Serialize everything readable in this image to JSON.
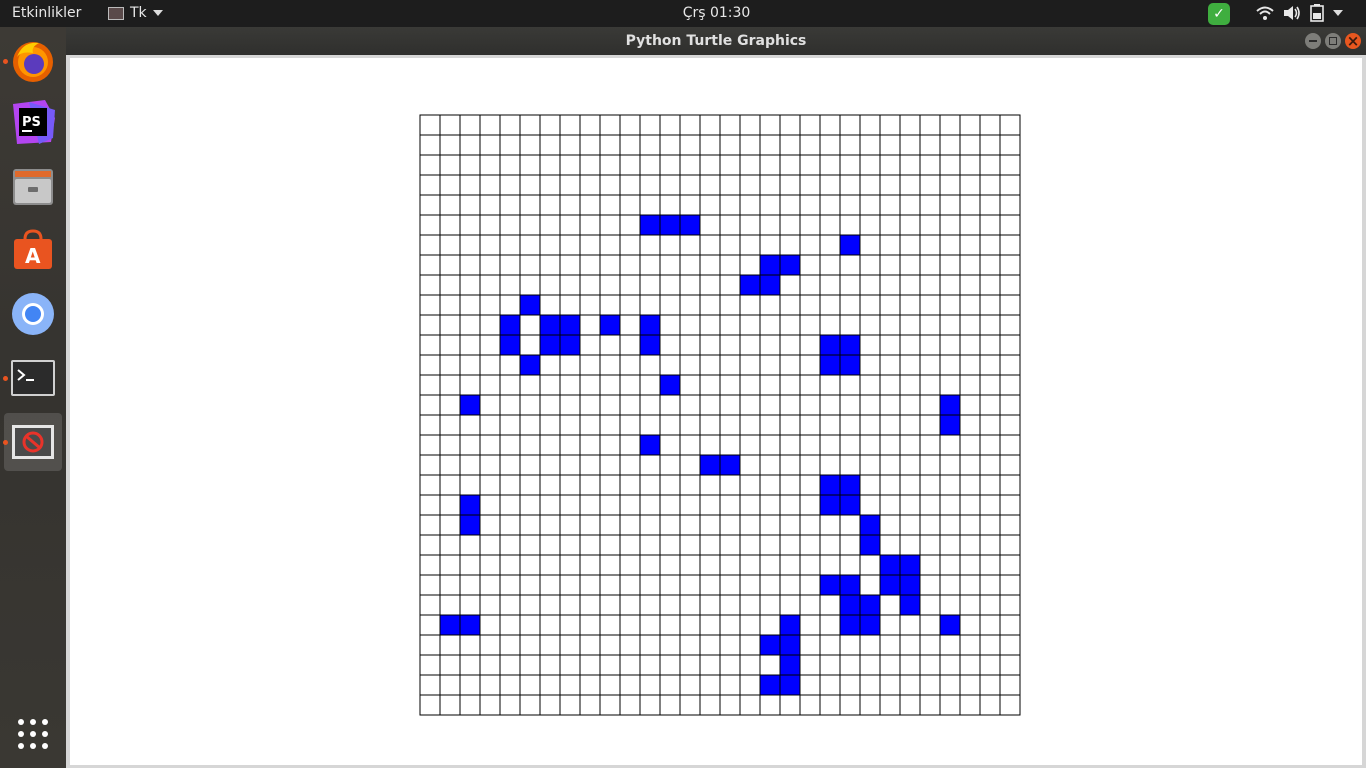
{
  "topbar": {
    "activities": "Etkinlikler",
    "app_name": "Tk",
    "clock": "Çrş 01:30"
  },
  "dock": {
    "items": [
      {
        "name": "firefox-icon",
        "running": true
      },
      {
        "name": "phpstorm-icon",
        "running": false
      },
      {
        "name": "files-icon",
        "running": false
      },
      {
        "name": "software-center-icon",
        "running": false
      },
      {
        "name": "chromium-icon",
        "running": false
      },
      {
        "name": "terminal-icon",
        "running": true
      },
      {
        "name": "tk-window-icon",
        "running": true,
        "active": true
      }
    ],
    "apps_grid_icon": "show-applications-icon"
  },
  "window": {
    "title": "Python Turtle Graphics"
  },
  "grid": {
    "rows": 30,
    "cols": 30,
    "fill_color": "#0000ff",
    "line_color": "#000000",
    "filled_cells": [
      [
        5,
        11
      ],
      [
        5,
        12
      ],
      [
        5,
        13
      ],
      [
        6,
        21
      ],
      [
        7,
        17
      ],
      [
        7,
        18
      ],
      [
        8,
        16
      ],
      [
        8,
        17
      ],
      [
        9,
        5
      ],
      [
        10,
        4
      ],
      [
        10,
        6
      ],
      [
        10,
        7
      ],
      [
        10,
        9
      ],
      [
        10,
        11
      ],
      [
        11,
        4
      ],
      [
        11,
        6
      ],
      [
        11,
        7
      ],
      [
        11,
        11
      ],
      [
        11,
        20
      ],
      [
        11,
        21
      ],
      [
        12,
        5
      ],
      [
        12,
        20
      ],
      [
        12,
        21
      ],
      [
        13,
        12
      ],
      [
        14,
        2
      ],
      [
        14,
        26
      ],
      [
        15,
        26
      ],
      [
        16,
        11
      ],
      [
        17,
        14
      ],
      [
        17,
        15
      ],
      [
        18,
        20
      ],
      [
        18,
        21
      ],
      [
        19,
        2
      ],
      [
        19,
        20
      ],
      [
        19,
        21
      ],
      [
        20,
        2
      ],
      [
        20,
        22
      ],
      [
        21,
        22
      ],
      [
        22,
        23
      ],
      [
        22,
        24
      ],
      [
        23,
        20
      ],
      [
        23,
        21
      ],
      [
        23,
        23
      ],
      [
        23,
        24
      ],
      [
        24,
        21
      ],
      [
        24,
        22
      ],
      [
        24,
        24
      ],
      [
        25,
        1
      ],
      [
        25,
        2
      ],
      [
        25,
        18
      ],
      [
        25,
        21
      ],
      [
        25,
        22
      ],
      [
        25,
        26
      ],
      [
        26,
        17
      ],
      [
        26,
        18
      ],
      [
        27,
        18
      ],
      [
        28,
        17
      ],
      [
        28,
        18
      ]
    ]
  }
}
